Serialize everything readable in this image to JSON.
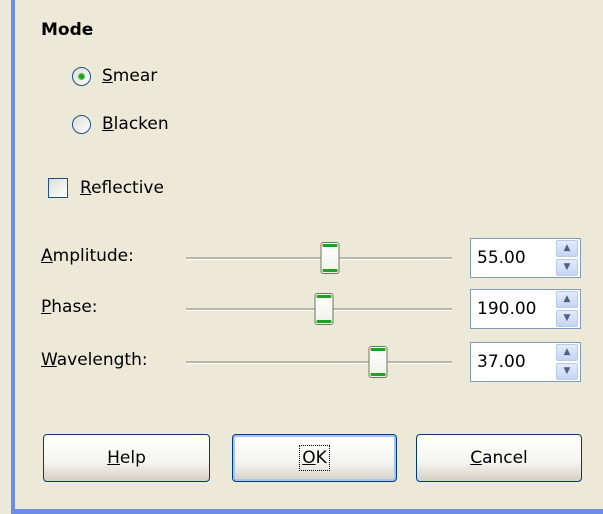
{
  "mode": {
    "title": "Mode",
    "options": [
      {
        "label": "Smear",
        "accel": "S",
        "rest": "mear",
        "selected": true
      },
      {
        "label": "Blacken",
        "accel": "B",
        "rest": "lacken",
        "selected": false
      }
    ]
  },
  "reflective": {
    "label": "Reflective",
    "accel": "R",
    "rest": "eflective",
    "checked": false
  },
  "sliders": [
    {
      "label": "Amplitude:",
      "accel": "A",
      "rest": "mplitude:",
      "value": "55.00",
      "position_fraction": 0.55
    },
    {
      "label": "Phase:",
      "accel": "P",
      "rest": "hase:",
      "value": "190.00",
      "position_fraction": 0.53
    },
    {
      "label": "Wavelength:",
      "accel": "W",
      "rest": "avelength:",
      "value": "37.00",
      "position_fraction": 0.72
    }
  ],
  "buttons": {
    "help": {
      "label": "Help",
      "accel": "H",
      "rest": "elp"
    },
    "ok": {
      "label": "OK",
      "accel": "O",
      "rest": "K"
    },
    "cancel": {
      "label": "Cancel",
      "accel": "C",
      "rest": "ancel"
    }
  },
  "icons": {
    "spin_up": "spin-up-arrow-icon",
    "spin_down": "spin-down-arrow-icon"
  },
  "colors": {
    "accent": "#6b8de3",
    "check_green": "#21a121",
    "background": "#ece9d8"
  }
}
